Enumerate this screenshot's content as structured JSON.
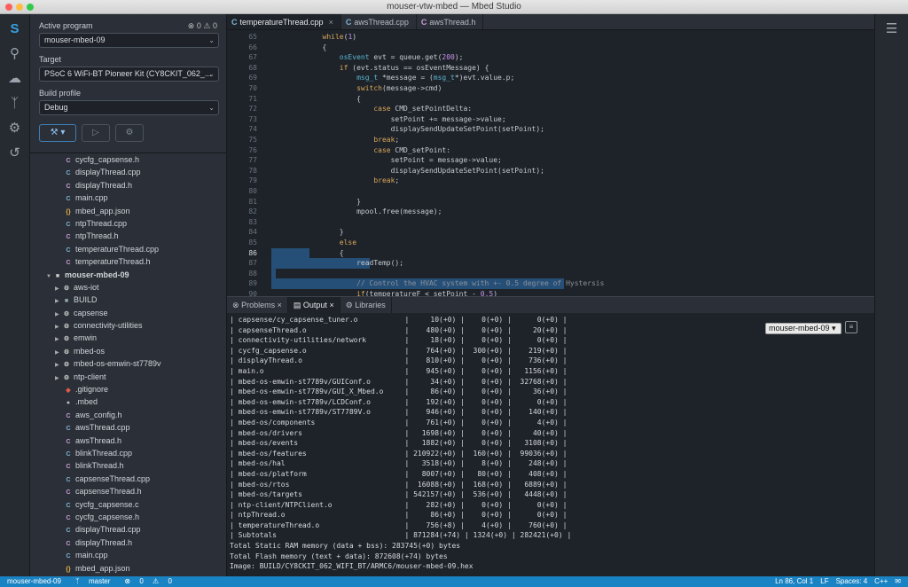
{
  "window": {
    "title": "mouser-vtw-mbed — Mbed Studio"
  },
  "activity": {
    "icons": [
      "mbed-logo-icon",
      "search-icon",
      "cloud-icon",
      "source-control-icon",
      "debug-icon",
      "history-icon"
    ]
  },
  "sidebar": {
    "active_program_label": "Active program",
    "errors": "0",
    "warnings": "0",
    "program": "mouser-mbed-09",
    "target_label": "Target",
    "target": "PSoC 6 WiFi-BT Pioneer Kit (CY8CKIT_062_...",
    "profile_label": "Build profile",
    "profile": "Debug"
  },
  "tree": [
    {
      "name": "cycfg_capsense.h",
      "kind": "h",
      "indent": 2
    },
    {
      "name": "displayThread.cpp",
      "kind": "cpp",
      "indent": 2
    },
    {
      "name": "displayThread.h",
      "kind": "h",
      "indent": 2
    },
    {
      "name": "main.cpp",
      "kind": "cpp",
      "indent": 2
    },
    {
      "name": "mbed_app.json",
      "kind": "json",
      "indent": 2
    },
    {
      "name": "ntpThread.cpp",
      "kind": "cpp",
      "indent": 2
    },
    {
      "name": "ntpThread.h",
      "kind": "h",
      "indent": 2
    },
    {
      "name": "temperatureThread.cpp",
      "kind": "cpp",
      "indent": 2
    },
    {
      "name": "temperatureThread.h",
      "kind": "h",
      "indent": 2
    },
    {
      "name": "mouser-mbed-09",
      "kind": "root",
      "indent": 0
    },
    {
      "name": "aws-iot",
      "kind": "lib",
      "indent": 1
    },
    {
      "name": "BUILD",
      "kind": "folder",
      "indent": 1
    },
    {
      "name": "capsense",
      "kind": "lib",
      "indent": 1
    },
    {
      "name": "connectivity-utilities",
      "kind": "lib",
      "indent": 1
    },
    {
      "name": "emwin",
      "kind": "lib",
      "indent": 1
    },
    {
      "name": "mbed-os",
      "kind": "lib",
      "indent": 1
    },
    {
      "name": "mbed-os-emwin-st7789v",
      "kind": "lib",
      "indent": 1
    },
    {
      "name": "ntp-client",
      "kind": "lib",
      "indent": 1
    },
    {
      "name": ".gitignore",
      "kind": "git",
      "indent": 2
    },
    {
      "name": ".mbed",
      "kind": "mbed",
      "indent": 2
    },
    {
      "name": "aws_config.h",
      "kind": "h",
      "indent": 2
    },
    {
      "name": "awsThread.cpp",
      "kind": "cpp",
      "indent": 2
    },
    {
      "name": "awsThread.h",
      "kind": "h",
      "indent": 2
    },
    {
      "name": "blinkThread.cpp",
      "kind": "cpp",
      "indent": 2
    },
    {
      "name": "blinkThread.h",
      "kind": "h",
      "indent": 2
    },
    {
      "name": "capsenseThread.cpp",
      "kind": "cpp",
      "indent": 2
    },
    {
      "name": "capsenseThread.h",
      "kind": "h",
      "indent": 2
    },
    {
      "name": "cycfg_capsense.c",
      "kind": "c",
      "indent": 2
    },
    {
      "name": "cycfg_capsense.h",
      "kind": "h",
      "indent": 2
    },
    {
      "name": "displayThread.cpp",
      "kind": "cpp",
      "indent": 2
    },
    {
      "name": "displayThread.h",
      "kind": "h",
      "indent": 2
    },
    {
      "name": "main.cpp",
      "kind": "cpp",
      "indent": 2
    },
    {
      "name": "mbed_app.json",
      "kind": "json",
      "indent": 2
    }
  ],
  "tabs": [
    {
      "label": "temperatureThread.cpp",
      "icon": "C",
      "active": true
    },
    {
      "label": "awsThread.cpp",
      "icon": "C",
      "active": false
    },
    {
      "label": "awsThread.h",
      "icon": "C",
      "active": false
    }
  ],
  "editor": {
    "cursor_line": 86,
    "lines": [
      {
        "n": "65",
        "t": "        while(1)"
      },
      {
        "n": "66",
        "t": "        {"
      },
      {
        "n": "67",
        "t": "            osEvent evt = queue.get(200);"
      },
      {
        "n": "68",
        "t": "            if (evt.status == osEventMessage) {"
      },
      {
        "n": "69",
        "t": "                msg_t *message = (msg_t*)evt.value.p;"
      },
      {
        "n": "70",
        "t": "                switch(message->cmd)"
      },
      {
        "n": "71",
        "t": "                {"
      },
      {
        "n": "72",
        "t": "                    case CMD_setPointDelta:"
      },
      {
        "n": "73",
        "t": "                        setPoint += message->value;"
      },
      {
        "n": "74",
        "t": "                        displaySendUpdateSetPoint(setPoint);"
      },
      {
        "n": "75",
        "t": "                    break;"
      },
      {
        "n": "76",
        "t": "                    case CMD_setPoint:"
      },
      {
        "n": "77",
        "t": "                        setPoint = message->value;"
      },
      {
        "n": "78",
        "t": "                        displaySendUpdateSetPoint(setPoint);"
      },
      {
        "n": "79",
        "t": "                    break;"
      },
      {
        "n": "80",
        "t": ""
      },
      {
        "n": "81",
        "t": "                }"
      },
      {
        "n": "82",
        "t": "                mpool.free(message);"
      },
      {
        "n": "83",
        "t": ""
      },
      {
        "n": "84",
        "t": "            }"
      },
      {
        "n": "85",
        "t": "            else"
      },
      {
        "n": "86",
        "t": "            {"
      },
      {
        "n": "87",
        "t": "                readTemp();"
      },
      {
        "n": "88",
        "t": ""
      },
      {
        "n": "89",
        "t": "                // Control the HVAC system with +- 0.5 degree of Hystersis"
      },
      {
        "n": "90",
        "t": "                if(temperatureF < setPoint - 0.5)"
      }
    ]
  },
  "panel": {
    "tabs": [
      "Problems",
      "Output",
      "Libraries"
    ],
    "target_select": "mouser-mbed-09",
    "output": [
      "| capsense/cy_capsense_tuner.o           |     10(+0) |    0(+0) |      0(+0) |",
      "| capsenseThread.o                       |    480(+0) |    0(+0) |     20(+0) |",
      "| connectivity-utilities/network         |     18(+0) |    0(+0) |      0(+0) |",
      "| cycfg_capsense.o                       |    764(+0) |  300(+0) |    219(+0) |",
      "| displayThread.o                        |    810(+0) |    0(+0) |    736(+0) |",
      "| main.o                                 |    945(+0) |    0(+0) |   1156(+0) |",
      "| mbed-os-emwin-st7789v/GUIConf.o        |     34(+0) |    0(+0) |  32768(+0) |",
      "| mbed-os-emwin-st7789v/GUI_X_Mbed.o     |     86(+0) |    0(+0) |     36(+0) |",
      "| mbed-os-emwin-st7789v/LCDConf.o        |    192(+0) |    0(+0) |      0(+0) |",
      "| mbed-os-emwin-st7789v/ST7789V.o        |    946(+0) |    0(+0) |    140(+0) |",
      "| mbed-os/components                     |    761(+0) |    0(+0) |      4(+0) |",
      "| mbed-os/drivers                        |   1698(+0) |    0(+0) |     40(+0) |",
      "| mbed-os/events                         |   1882(+0) |    0(+0) |   3108(+0) |",
      "| mbed-os/features                       | 210922(+0) |  160(+0) |  99036(+0) |",
      "| mbed-os/hal                            |   3518(+0) |    8(+0) |    248(+0) |",
      "| mbed-os/platform                       |   8007(+0) |   80(+0) |    408(+0) |",
      "| mbed-os/rtos                           |  16088(+0) |  168(+0) |   6889(+0) |",
      "| mbed-os/targets                        | 542157(+0) |  536(+0) |   4448(+0) |",
      "| ntp-client/NTPClient.o                 |    282(+0) |    0(+0) |      0(+0) |",
      "| ntpThread.o                            |     86(+0) |    0(+0) |      0(+0) |",
      "| temperatureThread.o                    |    756(+8) |    4(+0) |    760(+0) |",
      "| Subtotals                              | 871284(+74) | 1324(+0) | 282421(+0) |",
      "Total Static RAM memory (data + bss): 283745(+0) bytes",
      "Total Flash memory (text + data): 872608(+74) bytes",
      "Image: BUILD/CY8CKIT_062_WIFI_BT/ARMC6/mouser-mbed-09.hex"
    ]
  },
  "status": {
    "program": "mouser-mbed-09",
    "branch": "master",
    "errors": "0",
    "warnings": "0",
    "position": "Ln 86, Col 1",
    "eol": "LF",
    "spaces": "Spaces: 4",
    "lang": "C++"
  }
}
